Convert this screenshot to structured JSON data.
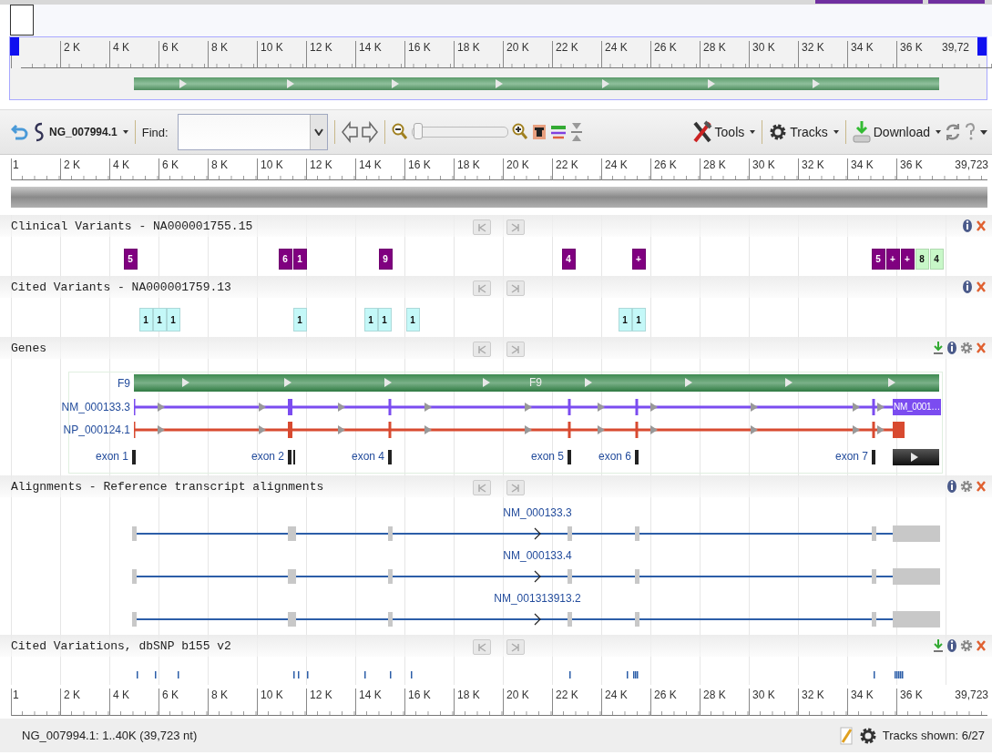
{
  "overview": {
    "ruler": {
      "ticks": [
        "2 K",
        "4 K",
        "6 K",
        "8 K",
        "10 K",
        "12 K",
        "14 K",
        "16 K",
        "18 K",
        "20 K",
        "22 K",
        "24 K",
        "26 K",
        "28 K",
        "30 K",
        "32 K",
        "34 K",
        "36 K"
      ],
      "end_label": "39,72"
    }
  },
  "toolbar": {
    "sequence": "NG_007994.1",
    "find_label": "Find:",
    "zoom": {
      "level": 0.02
    },
    "menus": [
      {
        "kind": "tools",
        "label": "Tools"
      },
      {
        "kind": "tracks",
        "label": "Tracks"
      },
      {
        "kind": "download",
        "label": "Download"
      }
    ]
  },
  "ruler": {
    "start_label": "1",
    "ticks": [
      "2 K",
      "4 K",
      "6 K",
      "8 K",
      "10 K",
      "12 K",
      "14 K",
      "16 K",
      "18 K",
      "20 K",
      "22 K",
      "24 K",
      "26 K",
      "28 K",
      "30 K",
      "32 K",
      "34 K",
      "36 K"
    ],
    "end_label": "39,723"
  },
  "tracks": [
    {
      "kind": "variants",
      "title": "Clinical Variants - NA000001755.15",
      "has_download": false,
      "has_settings": false,
      "features": [
        {
          "label": "5",
          "color": "#800080"
        },
        {
          "label": "6",
          "color": "#800080"
        },
        {
          "label": "1",
          "color": "#800080"
        },
        {
          "label": "9",
          "color": "#800080"
        },
        {
          "label": "4",
          "color": "#800080"
        },
        {
          "label": "+",
          "color": "#800080"
        },
        {
          "label": "5",
          "color": "#800080"
        },
        {
          "label": "+",
          "color": "#800080"
        },
        {
          "label": "+",
          "color": "#800080"
        },
        {
          "label": "8",
          "color": "#c8f7c8"
        },
        {
          "label": "4",
          "color": "#c8f7c8"
        }
      ]
    },
    {
      "kind": "variants",
      "title": "Cited Variants - NA000001759.13",
      "has_download": false,
      "has_settings": false,
      "features": [
        {
          "label": "1",
          "color": "#c4f8f8"
        },
        {
          "label": "1",
          "color": "#c4f8f8"
        },
        {
          "label": "1",
          "color": "#c4f8f8"
        },
        {
          "label": "1",
          "color": "#c4f8f8"
        },
        {
          "label": "1",
          "color": "#c4f8f8"
        },
        {
          "label": "1",
          "color": "#c4f8f8"
        },
        {
          "label": "1",
          "color": "#c4f8f8"
        },
        {
          "label": "1",
          "color": "#c4f8f8"
        },
        {
          "label": "1",
          "color": "#c4f8f8"
        }
      ]
    },
    {
      "kind": "genes",
      "title": "Genes",
      "has_download": true,
      "has_settings": true,
      "gene": {
        "label": "F9",
        "inner_label": "F9"
      },
      "transcript": {
        "label": "NM_000133.3",
        "end_label": "NM_0001…"
      },
      "protein": {
        "label": "NP_000124.1"
      },
      "exons": [
        "exon 1",
        "exon 2",
        "exon 4",
        "exon 5",
        "exon 6",
        "exon 7"
      ]
    },
    {
      "kind": "alignments",
      "title": "Alignments - Reference transcript alignments",
      "has_download": false,
      "has_settings": true,
      "rows": [
        {
          "label": "NM_000133.3"
        },
        {
          "label": "NM_000133.4"
        },
        {
          "label": "NM_001313913.2"
        }
      ]
    },
    {
      "kind": "snp",
      "title": "Cited Variations, dbSNP b155 v2",
      "has_download": true,
      "has_settings": true
    }
  ],
  "bottom_ruler": {
    "start_label": "1",
    "ticks": [
      "2 K",
      "4 K",
      "6 K",
      "8 K",
      "10 K",
      "12 K",
      "14 K",
      "16 K",
      "18 K",
      "20 K",
      "22 K",
      "24 K",
      "26 K",
      "28 K",
      "30 K",
      "32 K",
      "34 K",
      "36 K"
    ],
    "end_label": "39,723"
  },
  "status_bar": {
    "location": "NG_007994.1: 1..40K (39,723 nt)",
    "tracks_shown": "Tracks shown: 6/27"
  }
}
